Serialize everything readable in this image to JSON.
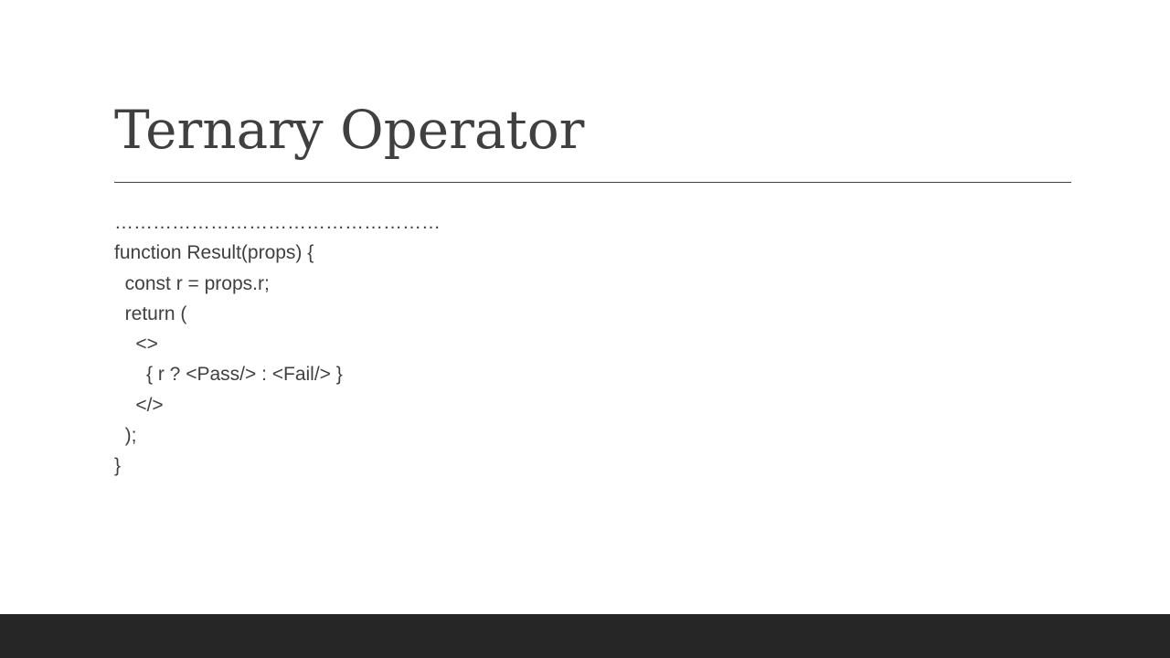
{
  "slide": {
    "title": "Ternary Operator",
    "code_lines": [
      "……………………………………………",
      "function Result(props) {",
      "  const r = props.r;",
      "  return (",
      "    <>",
      "      { r ? <Pass/> : <Fail/> }",
      "    </>",
      "  );",
      "}"
    ]
  },
  "colors": {
    "text": "#404040",
    "background": "#ffffff",
    "footer_band": "#262626",
    "rule": "#404040"
  }
}
